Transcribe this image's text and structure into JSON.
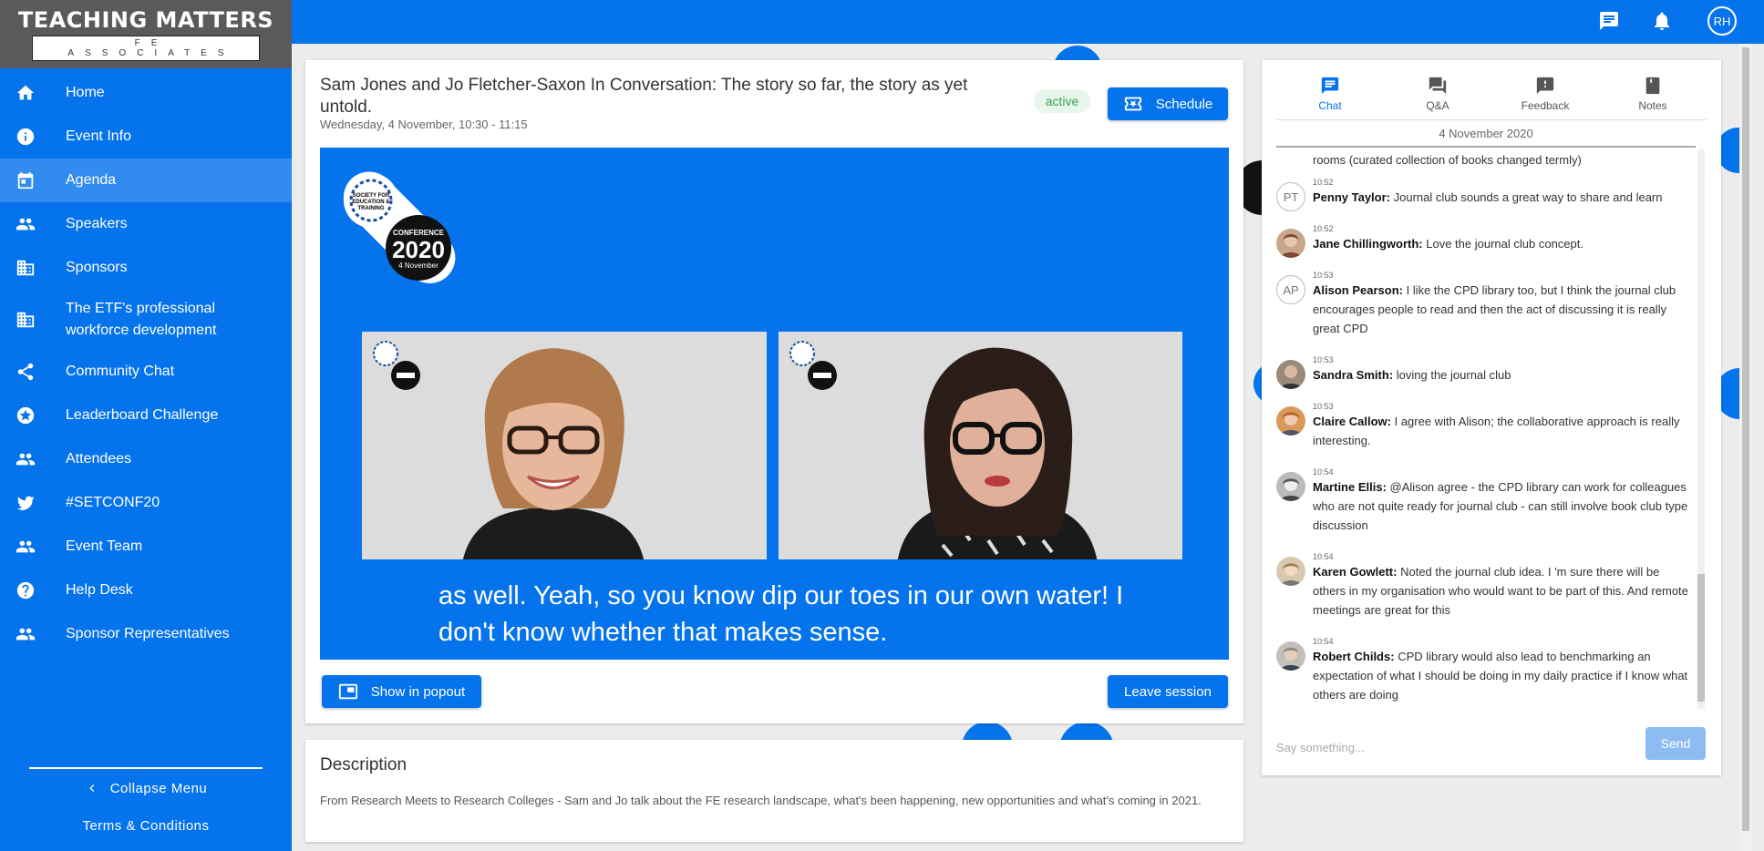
{
  "brand": {
    "name": "TEACHING MATTERS",
    "sub": "FE ASSOCIATES"
  },
  "sidebar": {
    "items": [
      {
        "label": "Home",
        "icon": "home-icon"
      },
      {
        "label": "Event Info",
        "icon": "info-icon"
      },
      {
        "label": "Agenda",
        "icon": "calendar-icon",
        "active": true
      },
      {
        "label": "Speakers",
        "icon": "people-icon"
      },
      {
        "label": "Sponsors",
        "icon": "building-icon"
      },
      {
        "label": "The ETF's professional workforce development",
        "icon": "building-icon"
      },
      {
        "label": "Community Chat",
        "icon": "share-icon"
      },
      {
        "label": "Leaderboard Challenge",
        "icon": "star-badge-icon"
      },
      {
        "label": "Attendees",
        "icon": "people-icon"
      },
      {
        "label": "#SETCONF20",
        "icon": "twitter-icon"
      },
      {
        "label": "Event Team",
        "icon": "people-icon"
      },
      {
        "label": "Help Desk",
        "icon": "help-icon"
      },
      {
        "label": "Sponsor Representatives",
        "icon": "people-icon"
      }
    ],
    "collapse_label": "Collapse Menu",
    "terms_label": "Terms & Conditions"
  },
  "topbar": {
    "avatar_initials": "RH"
  },
  "session": {
    "title": "Sam Jones and Jo Fletcher-Saxon In Conversation: The story so far, the story as yet untold.",
    "time": "Wednesday, 4 November, 10:30 - 11:15",
    "status": "active",
    "schedule_label": "Schedule",
    "popout_label": "Show in popout",
    "leave_label": "Leave session",
    "caption": "as well. Yeah, so you know dip our toes in our own water! I don't know whether that makes sense.",
    "conference_logo": {
      "line1": "SOCIETY FOR",
      "line2": "EDUCATION &",
      "line3": "TRAINING",
      "badge_top": "CONFERENCE",
      "badge_year": "2020",
      "badge_date": "4 November"
    }
  },
  "description": {
    "title": "Description",
    "text": "From Research Meets to Research Colleges - Sam and Jo talk about the FE research landscape, what's been happening, new opportunities and what's coming in 2021."
  },
  "chat": {
    "tabs": [
      {
        "label": "Chat",
        "icon": "chat-icon",
        "active": true
      },
      {
        "label": "Q&A",
        "icon": "forum-icon"
      },
      {
        "label": "Feedback",
        "icon": "feedback-icon"
      },
      {
        "label": "Notes",
        "icon": "bookmark-icon"
      }
    ],
    "date": "4 November 2020",
    "first_line": "rooms (curated collection of books changed termly)",
    "messages": [
      {
        "time": "10:52",
        "author": "Penny Taylor:",
        "text": "Journal club sounds a great way to share and learn",
        "initials": "PT"
      },
      {
        "time": "10:52",
        "author": "Jane Chillingworth:",
        "text": "Love the journal club concept.",
        "initials": ""
      },
      {
        "time": "10:53",
        "author": "Alison Pearson:",
        "text": "I like the CPD library too, but I think the journal club encourages people to read and then the act of discussing it is really great CPD",
        "initials": "AP"
      },
      {
        "time": "10:53",
        "author": "Sandra Smith:",
        "text": "loving the journal club",
        "initials": ""
      },
      {
        "time": "10:53",
        "author": "Claire Callow:",
        "text": "I agree with Alison; the collaborative approach is really interesting.",
        "initials": ""
      },
      {
        "time": "10:54",
        "author": "Martine Ellis:",
        "text": "@Alison agree - the CPD library can work for colleagues who are not quite ready for journal club - can still involve book club type discussion",
        "initials": ""
      },
      {
        "time": "10:54",
        "author": "Karen Gowlett:",
        "text": "Noted the journal club idea. I 'm sure there will be others in my organisation who would want to be part of this. And remote meetings are great for this",
        "initials": ""
      },
      {
        "time": "10:54",
        "author": "Robert Childs:",
        "text": "CPD library would also lead to benchmarking an expectation of what I should be doing in my daily practice if I know what others are doing",
        "initials": ""
      }
    ],
    "input_placeholder": "Say something...",
    "send_label": "Send"
  },
  "colors": {
    "primary": "#0573ec",
    "active_chip_bg": "#e8f6ec",
    "active_chip_text": "#3aa156",
    "send_disabled": "#8dbcf3"
  }
}
